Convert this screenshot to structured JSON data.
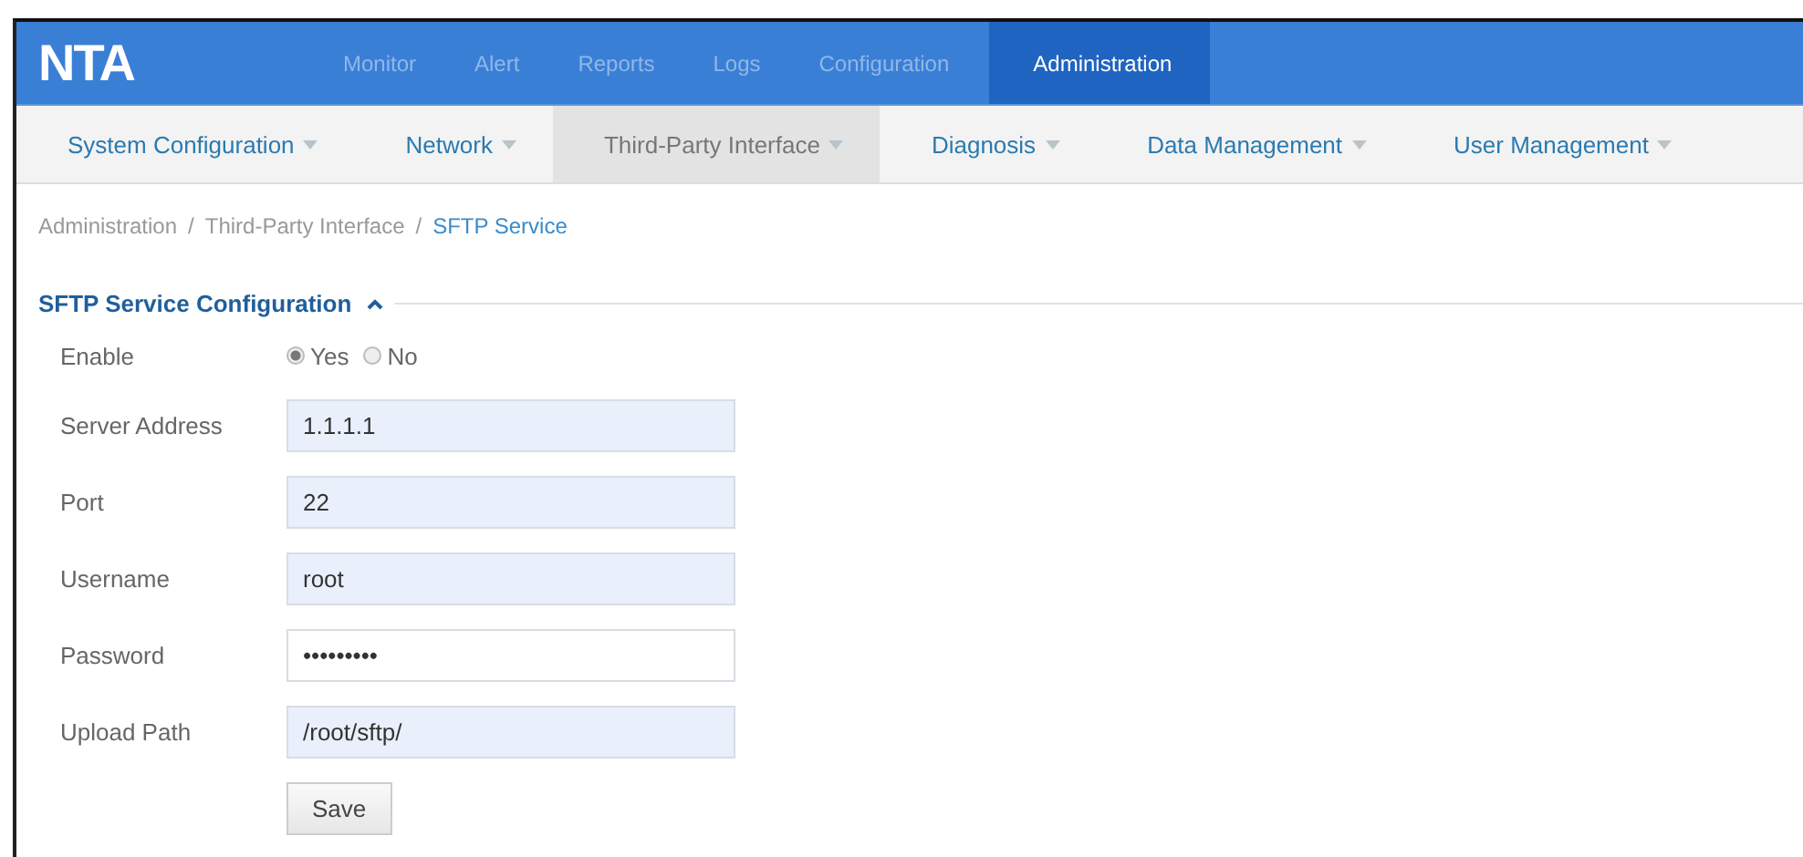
{
  "logo": "NTA",
  "main_menu": [
    {
      "label": "Monitor",
      "selected": false
    },
    {
      "label": "Alert",
      "selected": false
    },
    {
      "label": "Reports",
      "selected": false
    },
    {
      "label": "Logs",
      "selected": false
    },
    {
      "label": "Configuration",
      "selected": false
    },
    {
      "label": "Administration",
      "selected": true
    }
  ],
  "sub_menu": [
    {
      "label": "System Configuration",
      "selected": false
    },
    {
      "label": "Network",
      "selected": false
    },
    {
      "label": "Third-Party Interface",
      "selected": true
    },
    {
      "label": "Diagnosis",
      "selected": false
    },
    {
      "label": "Data Management",
      "selected": false
    },
    {
      "label": "User Management",
      "selected": false
    }
  ],
  "breadcrumb": {
    "items": [
      "Administration",
      "Third-Party Interface",
      "SFTP Service"
    ],
    "separators": [
      "/",
      "/"
    ]
  },
  "section": {
    "title": "SFTP Service Configuration",
    "expanded": true
  },
  "form": [
    {
      "kind": "radio",
      "label": "Enable",
      "options": [
        {
          "label": "Yes",
          "selected": true
        },
        {
          "label": "No",
          "selected": false
        }
      ]
    },
    {
      "kind": "text",
      "label": "Server Address",
      "value": "1.1.1.1",
      "filled": true
    },
    {
      "kind": "text",
      "label": "Port",
      "value": "22",
      "filled": true
    },
    {
      "kind": "text",
      "label": "Username",
      "value": "root",
      "filled": true
    },
    {
      "kind": "text",
      "label": "Password",
      "value": "•••••••••",
      "filled": false
    },
    {
      "kind": "text",
      "label": "Upload Path",
      "value": "/root/sftp/",
      "filled": true
    }
  ],
  "buttons": [
    "Save"
  ]
}
